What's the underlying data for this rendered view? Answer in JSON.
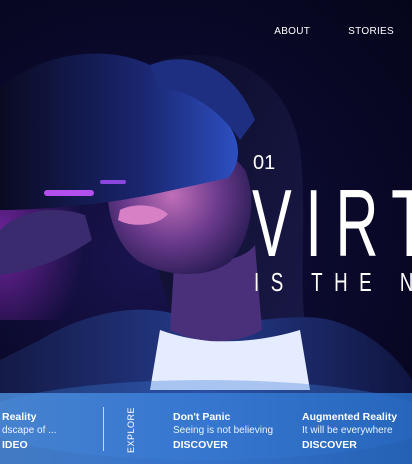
{
  "nav": {
    "about": "ABOUT",
    "stories": "STORIES"
  },
  "hero": {
    "slide_number": "01",
    "headline": "VIRT",
    "subheadline": "IS THE NE"
  },
  "explore_label": "EXPLORE",
  "cards": [
    {
      "title": "Reality",
      "description": "dscape of ...",
      "cta": "IDEO"
    },
    {
      "title": "Don't Panic",
      "description": "Seeing is not believing",
      "cta": "DISCOVER"
    },
    {
      "title": "Augmented Reality",
      "description": "It will be everywhere",
      "cta": "DISCOVER"
    }
  ],
  "colors": {
    "background": "#06061a",
    "accent_blue": "#3c82dc",
    "accent_magenta": "#d13cff",
    "text": "#ffffff"
  }
}
